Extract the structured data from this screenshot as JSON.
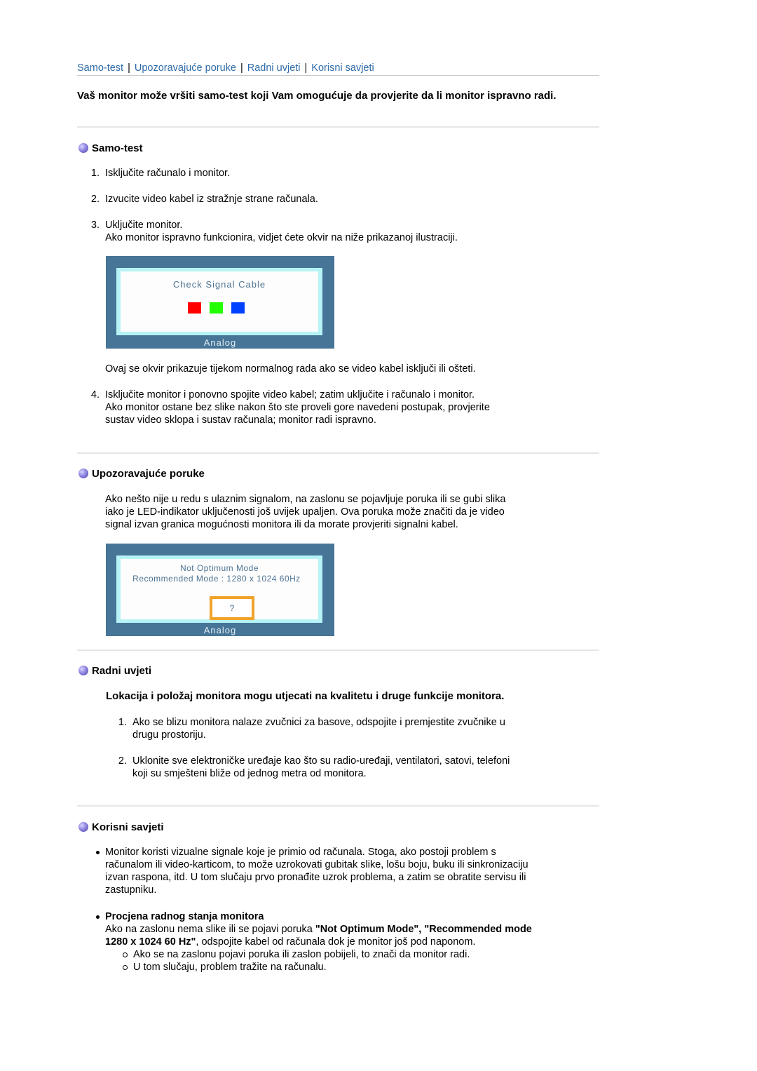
{
  "nav": {
    "links": [
      "Samo-test",
      "Upozoravajuće poruke",
      "Radni uvjeti",
      "Korisni savjeti"
    ],
    "separator": "|"
  },
  "intro": "Vaš monitor može vršiti samo-test koji Vam omogućuje da provjerite da li monitor ispravno radi.",
  "colors": {
    "link": "#2e6ba8",
    "monitor_frame": "#467597",
    "monitor_border": "#b7f3f6",
    "red": "#ff0000",
    "green": "#22ff00",
    "blue": "#0040ff",
    "orange": "#f0a22a"
  },
  "selftest": {
    "heading": "Samo-test",
    "steps": [
      {
        "num": "1.",
        "text": "Isključite računalo i monitor."
      },
      {
        "num": "2.",
        "text": "Izvucite video kabel iz stražnje strane računala."
      },
      {
        "num": "3.",
        "text": "Uključite monitor.",
        "extra": "Ako monitor ispravno funkcionira, vidjet ćete okvir na niže prikazanoj ilustraciji."
      }
    ],
    "monitor": {
      "title": "Check Signal Cable",
      "footer": "Analog"
    },
    "after_image": "Ovaj se okvir prikazuje tijekom normalnog rada ako se video kabel isključi ili ošteti.",
    "step4": {
      "num": "4.",
      "line1": "Isključite monitor i ponovno spojite video kabel; zatim uključite i računalo i monitor.",
      "line2": "Ako monitor ostane bez slike nakon što ste proveli gore navedeni postupak, provjerite",
      "line3": "sustav video sklopa i sustav računala; monitor radi ispravno."
    }
  },
  "warnings": {
    "heading": "Upozoravajuće poruke",
    "lines": [
      "Ako nešto nije u redu s ulaznim signalom, na zaslonu se pojavljuje poruka ili se gubi slika",
      "iako je LED-indikator uključenosti još uvijek upaljen. Ova poruka može značiti da je video",
      "signal izvan granica mogućnosti monitora ili da morate provjeriti signalni kabel."
    ],
    "monitor": {
      "title1": "Not Optimum Mode",
      "title2": "Recommended Mode :  1280 x 1024  60Hz",
      "question": "?",
      "footer": "Analog"
    }
  },
  "conditions": {
    "heading": "Radni uvjeti",
    "subheading": "Lokacija i položaj monitora mogu utjecati na kvalitetu i druge funkcije monitora.",
    "items": [
      {
        "num": "1.",
        "line1": "Ako se blizu monitora nalaze zvučnici za basove, odspojite i premjestite zvučnike u",
        "line2": "drugu prostoriju."
      },
      {
        "num": "2.",
        "line1": "Uklonite sve elektroničke uređaje kao što su radio-uređaji, ventilatori, satovi, telefoni",
        "line2": "koji su smješteni bliže od jednog metra od monitora."
      }
    ]
  },
  "tips": {
    "heading": "Korisni savjeti",
    "para_lines": [
      "Monitor koristi vizualne signale koje je primio od računala. Stoga, ako postoji problem s",
      "računalom ili video-karticom, to može uzrokovati gubitak slike, lošu boju, buku ili sinkronizaciju",
      "izvan raspona, itd. U tom slučaju prvo pronađite uzrok problema, a zatim se obratite servisu ili",
      "zastupniku."
    ],
    "eval_title": "Procjena radnog stanja monitora",
    "eval_line1_pre": "Ako na zaslonu nema slike ili se pojavi poruka ",
    "eval_line1_bold": "\"Not Optimum Mode\", \"Recommended mode",
    "eval_line2_bold": "1280 x 1024 60 Hz\"",
    "eval_line2_post": ", odspojite kabel od računala dok je monitor još pod naponom.",
    "sub_items": [
      "Ako se na zaslonu pojavi poruka ili zaslon pobijeli, to znači da monitor radi.",
      "U tom slučaju, problem tražite na računalu."
    ]
  }
}
